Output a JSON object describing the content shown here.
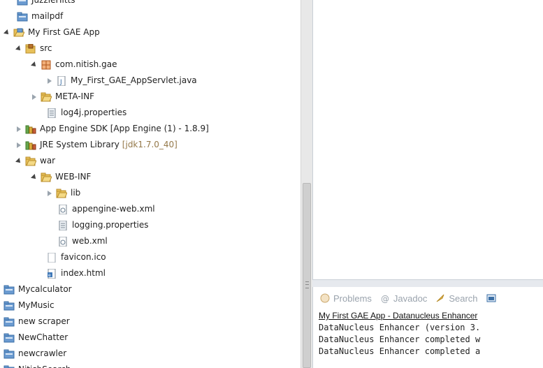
{
  "tree": {
    "items": [
      {
        "label": "JuzzleHitts",
        "decoration": "",
        "toggle": "none",
        "icon": "project-icon"
      },
      {
        "label": "mailpdf",
        "decoration": "",
        "toggle": "none",
        "icon": "project-icon"
      },
      {
        "label": "My First GAE App",
        "decoration": "",
        "toggle": "open",
        "icon": "open-project-icon"
      },
      {
        "label": "src",
        "decoration": "",
        "toggle": "open",
        "icon": "source-folder-icon"
      },
      {
        "label": "com.nitish.gae",
        "decoration": "",
        "toggle": "open",
        "icon": "package-icon"
      },
      {
        "label": "My_First_GAE_AppServlet.java",
        "decoration": "",
        "toggle": "closed",
        "icon": "java-file-icon"
      },
      {
        "label": "META-INF",
        "decoration": "",
        "toggle": "closed",
        "icon": "folder-icon"
      },
      {
        "label": "log4j.properties",
        "decoration": "",
        "toggle": "none",
        "icon": "properties-file-icon"
      },
      {
        "label": "App Engine SDK [App Engine (1) - 1.8.9]",
        "decoration": "",
        "toggle": "closed",
        "icon": "library-icon"
      },
      {
        "label": "JRE System Library",
        "decoration": "[jdk1.7.0_40]",
        "toggle": "closed",
        "icon": "library-icon"
      },
      {
        "label": "war",
        "decoration": "",
        "toggle": "open",
        "icon": "folder-icon"
      },
      {
        "label": "WEB-INF",
        "decoration": "",
        "toggle": "open",
        "icon": "folder-icon"
      },
      {
        "label": "lib",
        "decoration": "",
        "toggle": "closed",
        "icon": "folder-icon"
      },
      {
        "label": "appengine-web.xml",
        "decoration": "",
        "toggle": "none",
        "icon": "xml-file-icon"
      },
      {
        "label": "logging.properties",
        "decoration": "",
        "toggle": "none",
        "icon": "properties-file-icon"
      },
      {
        "label": "web.xml",
        "decoration": "",
        "toggle": "none",
        "icon": "xml-file-icon"
      },
      {
        "label": "favicon.ico",
        "decoration": "",
        "toggle": "none",
        "icon": "file-icon"
      },
      {
        "label": "index.html",
        "decoration": "",
        "toggle": "none",
        "icon": "html-file-icon"
      },
      {
        "label": "Mycalculator",
        "decoration": "",
        "toggle": "none",
        "icon": "project-icon"
      },
      {
        "label": "MyMusic",
        "decoration": "",
        "toggle": "none",
        "icon": "project-icon"
      },
      {
        "label": "new scraper",
        "decoration": "",
        "toggle": "none",
        "icon": "project-icon"
      },
      {
        "label": "NewChatter",
        "decoration": "",
        "toggle": "none",
        "icon": "project-icon"
      },
      {
        "label": "newcrawler",
        "decoration": "",
        "toggle": "none",
        "icon": "project-icon"
      },
      {
        "label": "NitishSearch",
        "decoration": "",
        "toggle": "none",
        "icon": "project-icon"
      }
    ]
  },
  "console": {
    "tabs": [
      {
        "label": "Problems",
        "icon": "problems-icon"
      },
      {
        "label": "Javadoc",
        "icon": "javadoc-icon"
      },
      {
        "label": "Search",
        "icon": "search-icon"
      },
      {
        "label": "",
        "icon": "console-icon"
      }
    ],
    "title": "My First GAE App - Datanucleus Enhancer",
    "lines": [
      "DataNucleus Enhancer (version 3.",
      "DataNucleus Enhancer completed w",
      "DataNucleus Enhancer completed a"
    ]
  },
  "colors": {
    "folder": "#e8c15a",
    "project": "#5a8fc6",
    "decoration": "#95794a",
    "tab_text": "#9aa3ad"
  }
}
